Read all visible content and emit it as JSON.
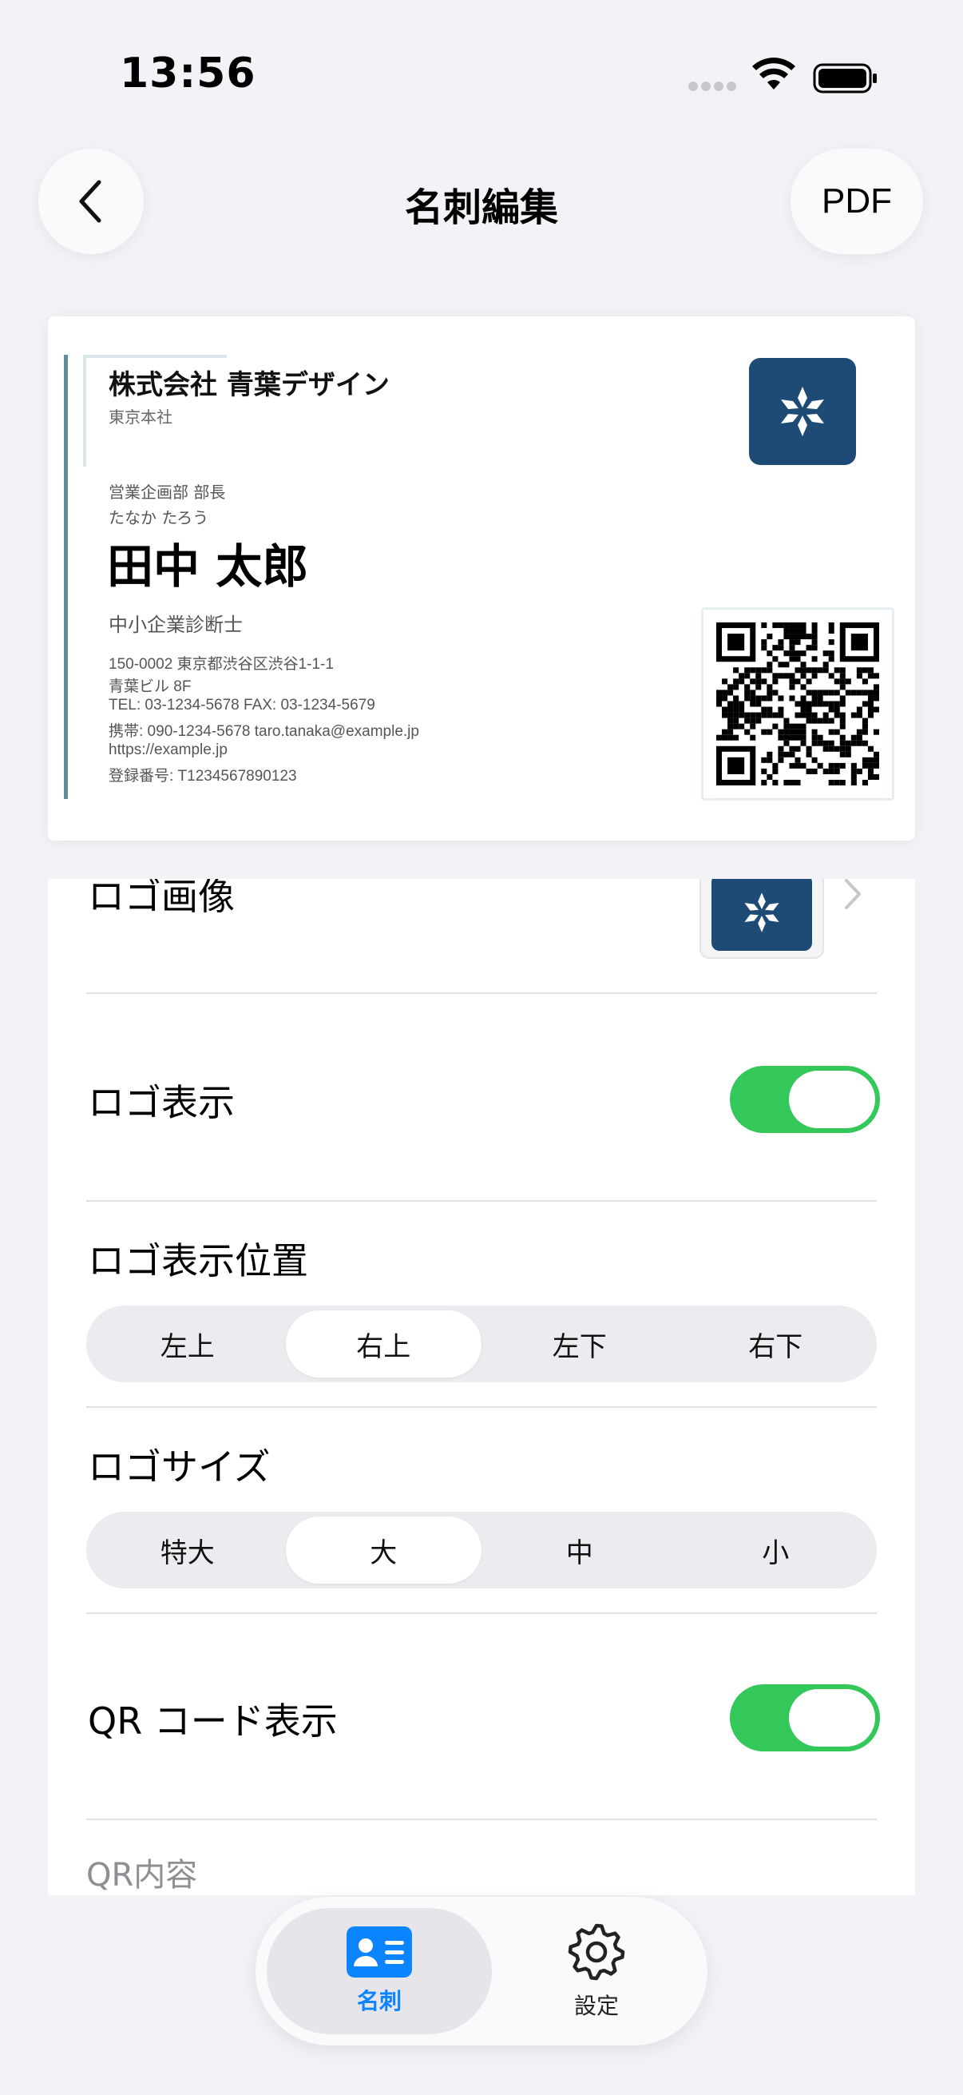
{
  "status_bar": {
    "time": "13:56"
  },
  "nav": {
    "title": "名刺編集",
    "pdf_label": "PDF"
  },
  "card": {
    "company": "株式会社 青葉デザイン",
    "branch": "東京本社",
    "department": "営業企画部 部長",
    "kana": "たなか たろう",
    "name": "田中 太郎",
    "certification": "中小企業診断士",
    "address_lines": [
      "150-0002 東京都渋谷区渋谷1-1-1",
      "青葉ビル 8F",
      "TEL: 03-1234-5678  FAX: 03-1234-5679",
      "携帯: 090-1234-5678  taro.tanaka@example.jp",
      "https://example.jp",
      "登録番号: T1234567890123"
    ],
    "logo_color": "#1e4a76",
    "accent_color": "#5f8f96"
  },
  "form": {
    "logo_image_label": "ロゴ画像",
    "logo_display_label": "ロゴ表示",
    "logo_display_on": true,
    "logo_position_label": "ロゴ表示位置",
    "logo_position_options": [
      "左上",
      "右上",
      "左下",
      "右下"
    ],
    "logo_position_selected": "右上",
    "logo_size_label": "ロゴサイズ",
    "logo_size_options": [
      "特大",
      "大",
      "中",
      "小"
    ],
    "logo_size_selected": "大",
    "qr_display_label": "QR コード表示",
    "qr_display_on": true,
    "qr_content_label": "QR内容",
    "toggle_on_color": "#34c759"
  },
  "tabbar": {
    "tabs": [
      {
        "label": "名刺",
        "icon": "contact-card-icon",
        "active": true
      },
      {
        "label": "設定",
        "icon": "gear-icon",
        "active": false
      }
    ],
    "active_color": "#0a84ff"
  }
}
